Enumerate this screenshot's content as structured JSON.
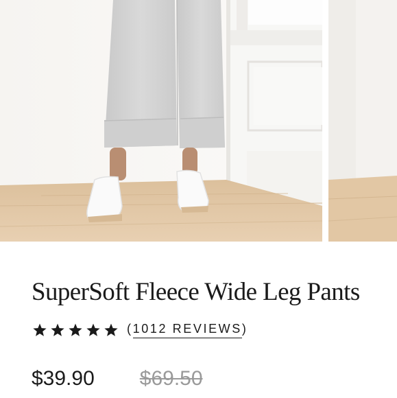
{
  "product": {
    "title": "SuperSoft Fleece Wide Leg Pants",
    "rating": {
      "stars": 5,
      "open_paren": "(",
      "reviews_text": "1012 REVIEWS",
      "close_paren": ")"
    },
    "price": {
      "sale": "$39.90",
      "original": "$69.50"
    }
  },
  "gallery": {
    "images": [
      {
        "alt": "product-photo-main"
      },
      {
        "alt": "product-photo-next"
      }
    ]
  },
  "colors": {
    "text": "#1a1a1a",
    "strikethrough": "#9a9a9a",
    "floor": "#e3c9a8",
    "pants": "#d2d2d2"
  }
}
